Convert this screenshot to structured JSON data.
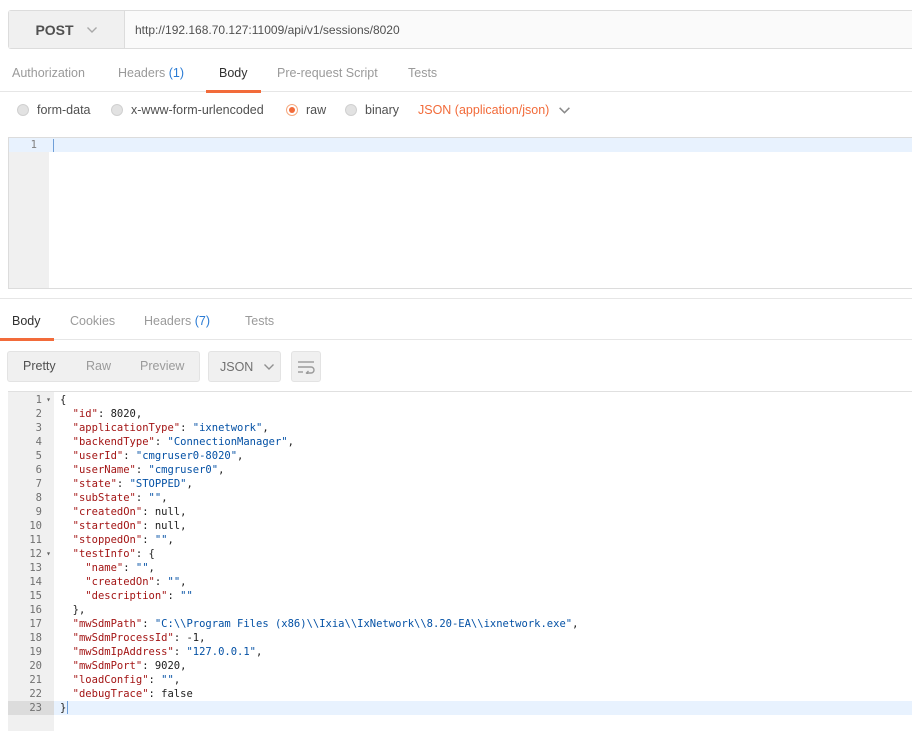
{
  "request": {
    "method": "POST",
    "url": "http://192.168.70.127:11009/api/v1/sessions/8020"
  },
  "request_tabs": [
    {
      "label": "Authorization",
      "count": ""
    },
    {
      "label": "Headers",
      "count": "(1)"
    },
    {
      "label": "Body",
      "count": ""
    },
    {
      "label": "Pre-request Script",
      "count": ""
    },
    {
      "label": "Tests",
      "count": ""
    }
  ],
  "body_modes": {
    "options": [
      "form-data",
      "x-www-form-urlencoded",
      "raw",
      "binary"
    ],
    "selected": "raw",
    "content_type": "JSON (application/json)"
  },
  "request_editor": {
    "line_numbers": [
      "1"
    ]
  },
  "response_tabs": [
    {
      "label": "Body",
      "count": ""
    },
    {
      "label": "Cookies",
      "count": ""
    },
    {
      "label": "Headers",
      "count": "(7)"
    },
    {
      "label": "Tests",
      "count": ""
    }
  ],
  "response_toolbar": {
    "views": [
      "Pretty",
      "Raw",
      "Preview"
    ],
    "active_view": "Pretty",
    "format": "JSON"
  },
  "response_body": {
    "lines": [
      "{",
      "  \"id\": 8020,",
      "  \"applicationType\": \"ixnetwork\",",
      "  \"backendType\": \"ConnectionManager\",",
      "  \"userId\": \"cmgruser0-8020\",",
      "  \"userName\": \"cmgruser0\",",
      "  \"state\": \"STOPPED\",",
      "  \"subState\": \"\",",
      "  \"createdOn\": null,",
      "  \"startedOn\": null,",
      "  \"stoppedOn\": \"\",",
      "  \"testInfo\": {",
      "    \"name\": \"\",",
      "    \"createdOn\": \"\",",
      "    \"description\": \"\"",
      "  },",
      "  \"mwSdmPath\": \"C:\\\\Program Files (x86)\\\\Ixia\\\\IxNetwork\\\\8.20-EA\\\\ixnetwork.exe\",",
      "  \"mwSdmProcessId\": -1,",
      "  \"mwSdmIpAddress\": \"127.0.0.1\",",
      "  \"mwSdmPort\": 9020,",
      "  \"loadConfig\": \"\",",
      "  \"debugTrace\": false",
      "}"
    ],
    "foldable_lines": [
      1,
      12
    ],
    "active_line": 23
  },
  "colors": {
    "accent": "#f26b3a",
    "count": "#2a7bd4",
    "json_key": "#a31515",
    "json_string": "#0451a5"
  },
  "icons": {
    "method_dropdown": "chevron-down-icon",
    "content_type_dropdown": "chevron-down-icon",
    "format_dropdown": "chevron-down-icon",
    "wrap": "wrap-lines-icon",
    "fold": "fold-arrow-icon"
  }
}
